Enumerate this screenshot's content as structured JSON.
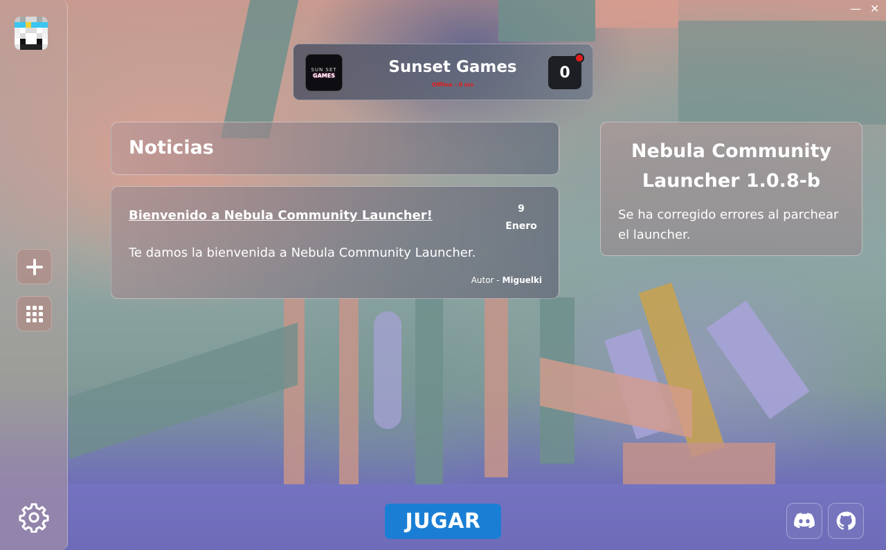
{
  "window": {
    "minimize_glyph": "—",
    "close_glyph": "✕"
  },
  "sidebar": {
    "avatar_icon": "player-skin-avatar",
    "add_icon": "plus-icon",
    "apps_icon": "grid-icon",
    "settings_icon": "gear-icon"
  },
  "server": {
    "logo_line1": "SUN SET",
    "logo_line2": "GAMES",
    "name": "Sunset Games",
    "status": "Offline - 0 ms",
    "player_count": "0",
    "status_color": "#e21d1d"
  },
  "news": {
    "header": "Noticias",
    "items": [
      {
        "title": "Bienvenido a Nebula Community Launcher!",
        "day": "9",
        "month": "Enero",
        "body": "Te damos la bienvenida a Nebula Community Launcher.",
        "author_label": "Autor - ",
        "author": "Miguelki"
      }
    ]
  },
  "update": {
    "title": "Nebula Community Launcher 1.0.8-b",
    "body": "Se ha corregido errores al parchear el launcher."
  },
  "play_button": {
    "label": "JUGAR",
    "color": "#1a7fd4"
  },
  "social": {
    "discord_icon": "discord-icon",
    "github_icon": "github-icon"
  }
}
